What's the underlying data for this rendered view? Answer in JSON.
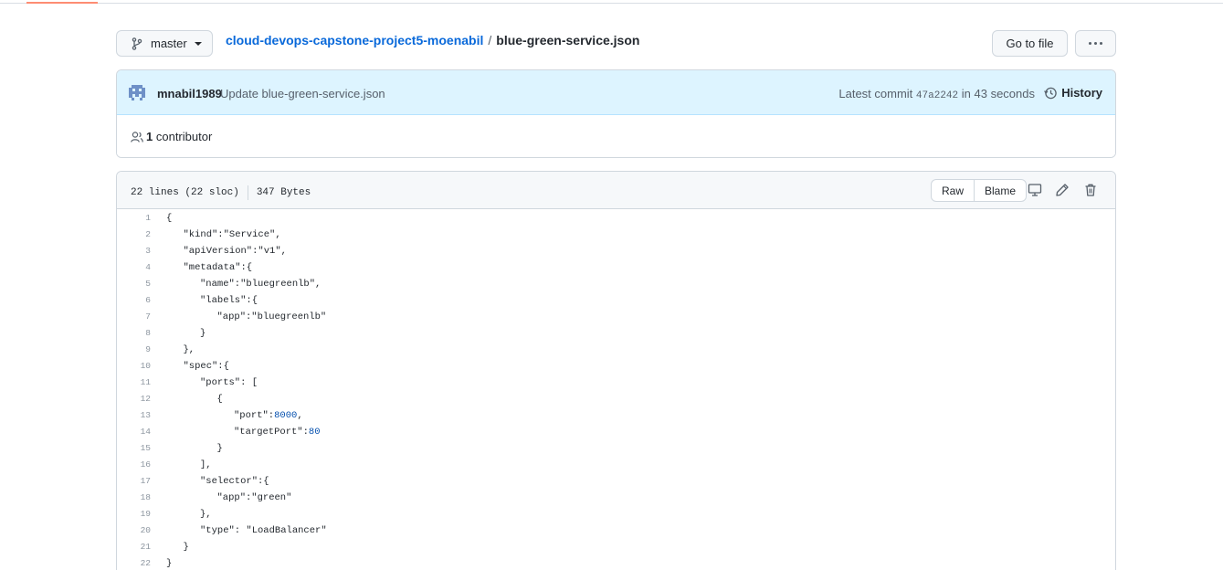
{
  "branch": {
    "label": "master"
  },
  "breadcrumb": {
    "repo": "cloud-devops-capstone-project5-moenabil",
    "separator": "/",
    "file": "blue-green-service.json"
  },
  "toolbar": {
    "goto_label": "Go to file",
    "more_icon": "kebab-horizontal-icon"
  },
  "commit": {
    "author": "mnabil1989",
    "message": "Update blue-green-service.json",
    "latest_prefix": "Latest commit",
    "sha": "47a2242",
    "time": "in 43 seconds",
    "history_label": "History"
  },
  "contributors": {
    "count": "1",
    "label": "contributor"
  },
  "file": {
    "lines_info": "22 lines (22 sloc)",
    "size": "347 Bytes",
    "raw_label": "Raw",
    "blame_label": "Blame",
    "icons": [
      "desktop-icon",
      "pencil-icon",
      "trash-icon"
    ]
  },
  "code": [
    {
      "n": "1",
      "indent": 0,
      "text": "{"
    },
    {
      "n": "2",
      "indent": 1,
      "text": "\"kind\":\"Service\","
    },
    {
      "n": "3",
      "indent": 1,
      "text": "\"apiVersion\":\"v1\","
    },
    {
      "n": "4",
      "indent": 1,
      "text": "\"metadata\":{"
    },
    {
      "n": "5",
      "indent": 2,
      "text": "\"name\":\"bluegreenlb\","
    },
    {
      "n": "6",
      "indent": 2,
      "text": "\"labels\":{"
    },
    {
      "n": "7",
      "indent": 3,
      "text": "\"app\":\"bluegreenlb\""
    },
    {
      "n": "8",
      "indent": 2,
      "text": "}"
    },
    {
      "n": "9",
      "indent": 1,
      "text": "},"
    },
    {
      "n": "10",
      "indent": 1,
      "text": "\"spec\":{"
    },
    {
      "n": "11",
      "indent": 2,
      "text": "\"ports\": ["
    },
    {
      "n": "12",
      "indent": 3,
      "text": "{"
    },
    {
      "n": "13",
      "indent": 4,
      "text": "\"port\":",
      "num": "8000",
      "after": ","
    },
    {
      "n": "14",
      "indent": 4,
      "text": "\"targetPort\":",
      "num": "80",
      "after": ""
    },
    {
      "n": "15",
      "indent": 3,
      "text": "}"
    },
    {
      "n": "16",
      "indent": 2,
      "text": "],"
    },
    {
      "n": "17",
      "indent": 2,
      "text": "\"selector\":{"
    },
    {
      "n": "18",
      "indent": 3,
      "text": "\"app\":\"green\""
    },
    {
      "n": "19",
      "indent": 2,
      "text": "},"
    },
    {
      "n": "20",
      "indent": 2,
      "text": "\"type\": \"LoadBalancer\""
    },
    {
      "n": "21",
      "indent": 1,
      "text": "}"
    },
    {
      "n": "22",
      "indent": 0,
      "text": "}"
    }
  ]
}
